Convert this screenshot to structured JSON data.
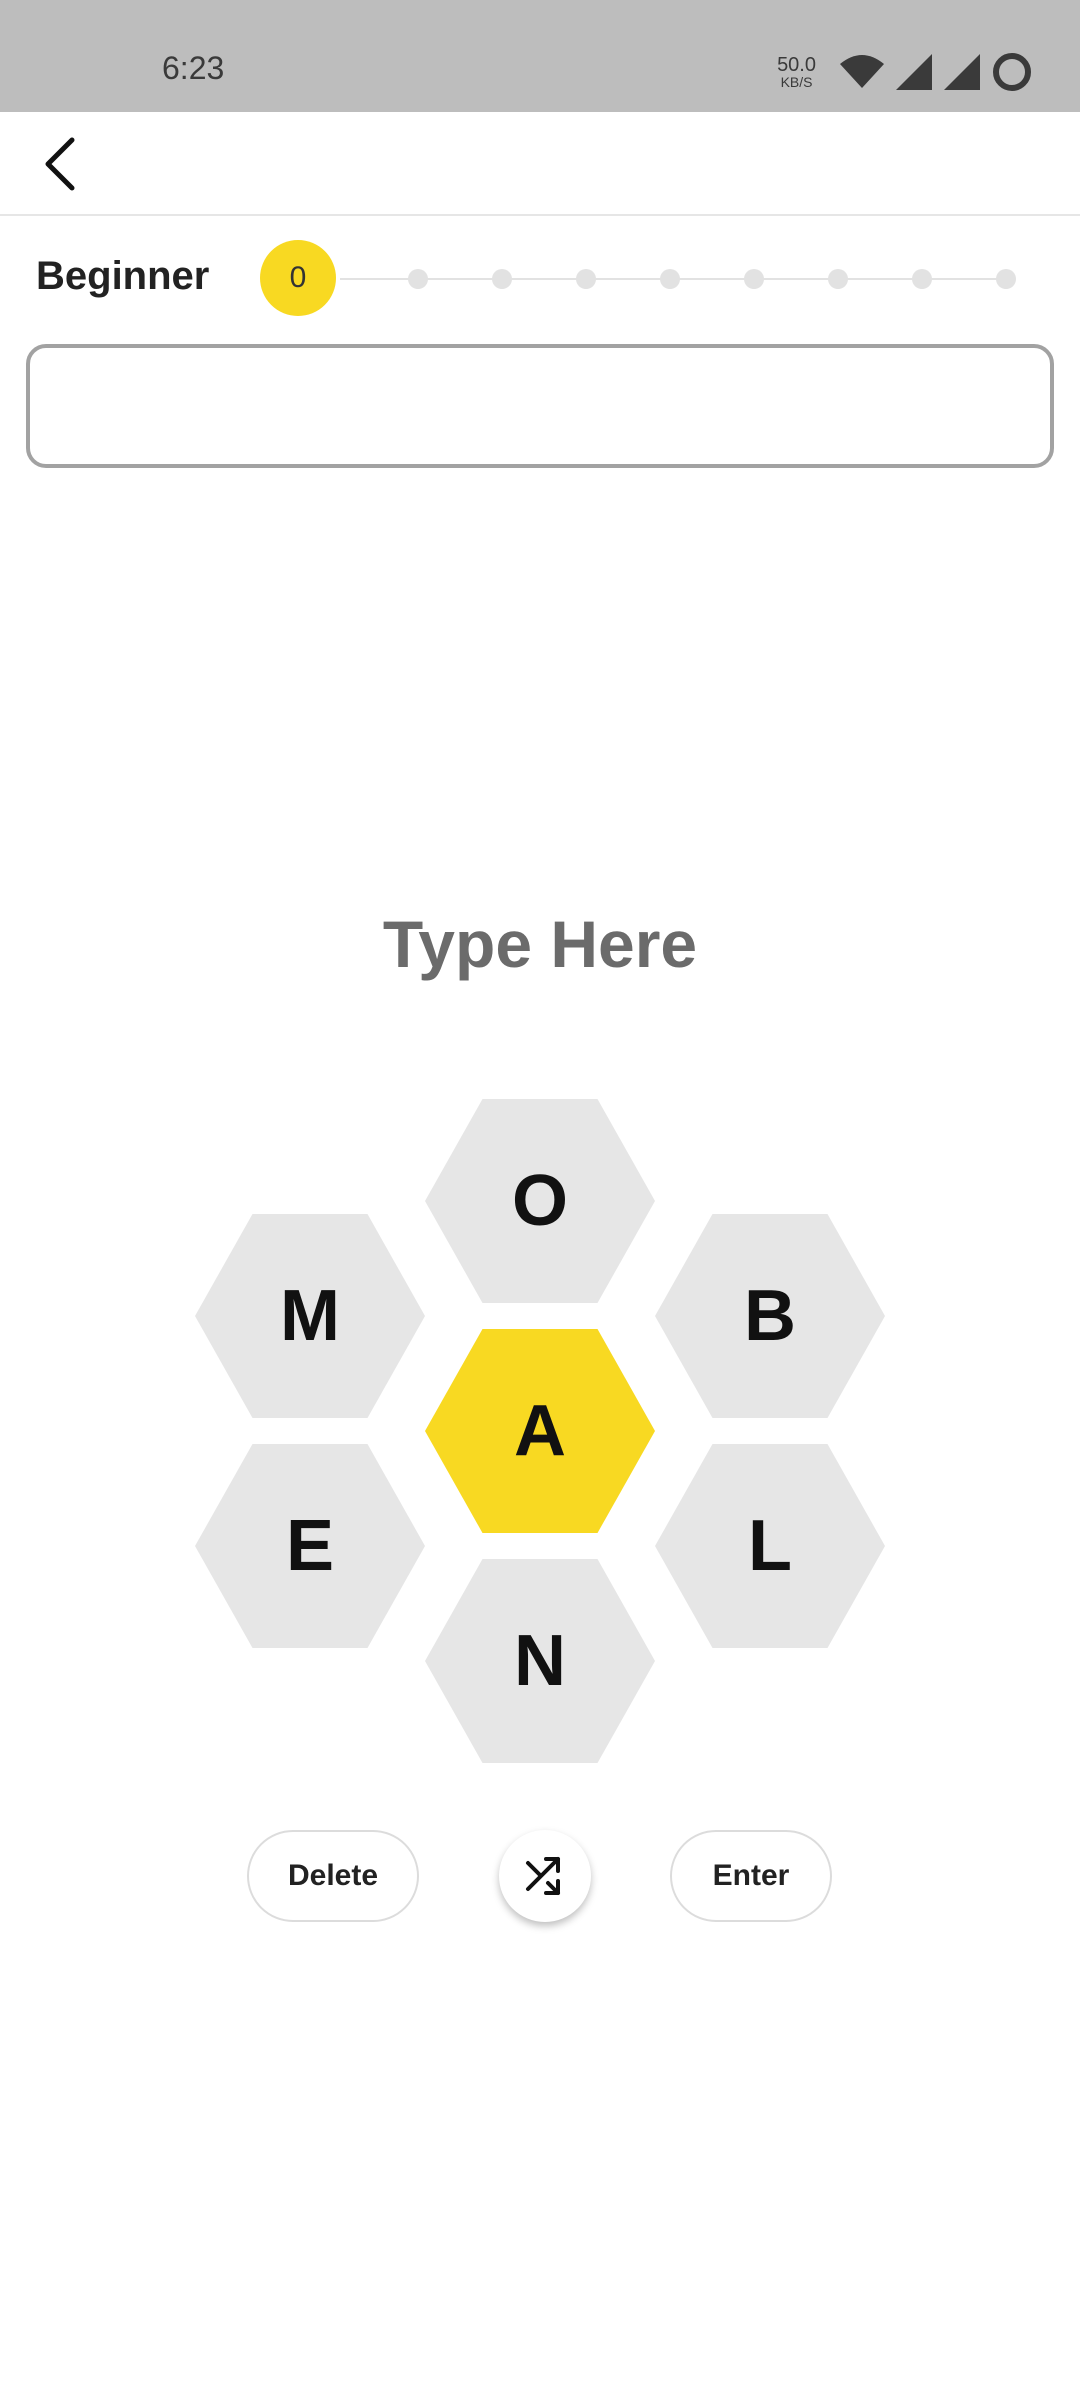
{
  "status_bar": {
    "time": "6:23",
    "net_speed_value": "50.0",
    "net_speed_unit": "KB/S",
    "icons": [
      "wifi-icon",
      "signal-icon",
      "signal-icon",
      "sync-icon"
    ]
  },
  "app_bar": {
    "back_icon": "chevron-left-icon"
  },
  "level": {
    "label": "Beginner",
    "score": "0",
    "milestones_total": 8
  },
  "game": {
    "prompt": "Type Here",
    "center_letter": "A",
    "outer_letters": {
      "top": "O",
      "upper_left": "M",
      "upper_right": "B",
      "lower_left": "E",
      "lower_right": "L",
      "bottom": "N"
    }
  },
  "controls": {
    "delete_label": "Delete",
    "enter_label": "Enter",
    "shuffle_icon": "shuffle-icon"
  },
  "colors": {
    "accent": "#f8d922",
    "hex_bg": "#e6e6e6",
    "status_bar_bg": "#bdbdbd"
  }
}
